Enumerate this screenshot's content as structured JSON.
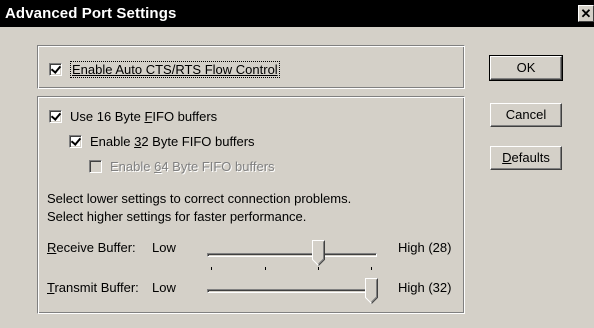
{
  "dialog": {
    "title": "Advanced Port Settings",
    "close_glyph": "✕"
  },
  "flow_control": {
    "checked": true,
    "label": "Enable Auto CTS/RTS Flow Control"
  },
  "fifo": {
    "use16": {
      "checked": true,
      "label_pre": "Use 16 Byte ",
      "accel": "F",
      "label_post": "IFO buffers"
    },
    "enable32": {
      "checked": true,
      "label_pre": "Enable ",
      "accel": "3",
      "label_post": "2 Byte FIFO buffers"
    },
    "enable64": {
      "checked": false,
      "disabled": true,
      "label_pre": "Enable ",
      "accel": "6",
      "label_post": "4 Byte FIFO buffers"
    },
    "hint_line1": "Select lower settings to correct connection problems.",
    "hint_line2": "Select higher settings for faster performance."
  },
  "receive": {
    "label_accel": "R",
    "label_rest": "eceive Buffer:",
    "low_label": "Low",
    "high_label": "High (28)",
    "value": 28,
    "ticks": 4
  },
  "transmit": {
    "label_accel": "T",
    "label_rest": "ransmit Buffer:",
    "low_label": "Low",
    "high_label": "High (32)",
    "value": 32
  },
  "buttons": {
    "ok": "OK",
    "cancel": "Cancel",
    "defaults_accel": "D",
    "defaults_rest": "efaults"
  }
}
